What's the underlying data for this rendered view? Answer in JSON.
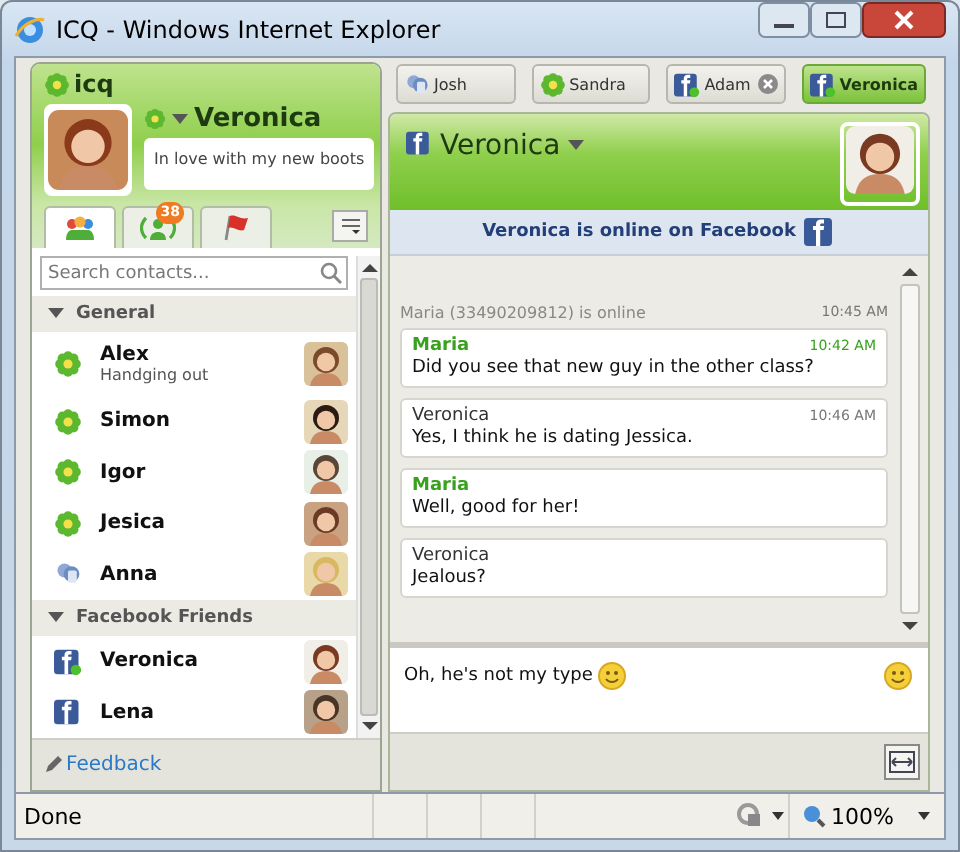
{
  "window": {
    "title": "ICQ - Windows Internet Explorer"
  },
  "app": {
    "logo": "icq"
  },
  "profile": {
    "name": "Veronica",
    "mood": "In love with my new boots"
  },
  "contact_tabs": [
    {
      "kind": "contacts",
      "selected": true
    },
    {
      "kind": "activity",
      "badge": "38",
      "selected": false
    },
    {
      "kind": "flag",
      "selected": false
    }
  ],
  "search": {
    "placeholder": "Search contacts..."
  },
  "groups": [
    {
      "name": "General",
      "expanded": true,
      "contacts": [
        {
          "name": "Alex",
          "status_text": "Handging out",
          "kind": "icq",
          "online": true
        },
        {
          "name": "Simon",
          "kind": "icq",
          "online": true
        },
        {
          "name": "Igor",
          "kind": "icq",
          "online": true
        },
        {
          "name": "Jesica",
          "kind": "icq",
          "online": true
        },
        {
          "name": "Anna",
          "kind": "buddy",
          "online": true
        }
      ]
    },
    {
      "name": "Facebook Friends",
      "expanded": true,
      "contacts": [
        {
          "name": "Veronica",
          "kind": "facebook",
          "online": true
        },
        {
          "name": "Lena",
          "kind": "facebook",
          "online": false
        }
      ]
    }
  ],
  "feedback": "Feedback",
  "chat_tabs": [
    {
      "name": "Josh",
      "kind": "buddy",
      "selected": false,
      "closable": false
    },
    {
      "name": "Sandra",
      "kind": "icq",
      "selected": false,
      "closable": false
    },
    {
      "name": "Adam",
      "kind": "facebook",
      "selected": false,
      "closable": true
    },
    {
      "name": "Veronica",
      "kind": "facebook",
      "selected": true,
      "closable": false
    }
  ],
  "chat": {
    "name": "Veronica",
    "kind": "facebook",
    "banner": "Veronica is online on Facebook",
    "messages": [
      {
        "kind": "status",
        "text": "Maria (33490209812) is online",
        "time": "10:45 AM"
      },
      {
        "kind": "message",
        "sender": "Maria",
        "incoming": true,
        "text": "Did you see that new guy in the other class?",
        "time": "10:42 AM"
      },
      {
        "kind": "message",
        "sender": "Veronica",
        "incoming": false,
        "text": "Yes, I think he is dating Jessica.",
        "time": "10:46 AM"
      },
      {
        "kind": "message",
        "sender": "Maria",
        "incoming": true,
        "text": "Well, good for her!"
      },
      {
        "kind": "message",
        "sender": "Veronica",
        "incoming": false,
        "text": "Jealous?"
      }
    ],
    "input": "Oh, he's not my type"
  },
  "status_bar": {
    "text": "Done",
    "zoom": "100%"
  }
}
